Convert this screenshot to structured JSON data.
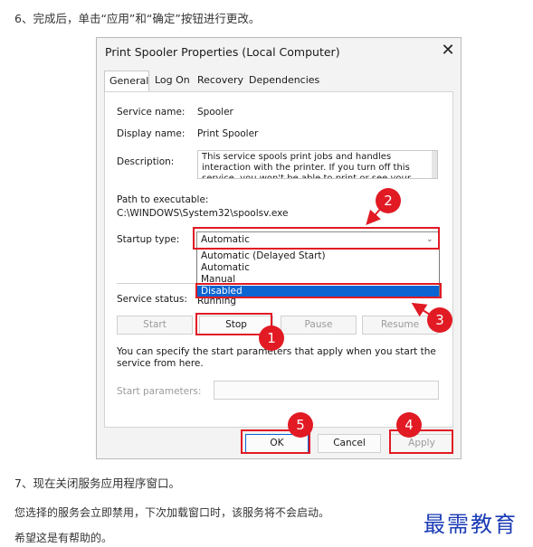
{
  "article": {
    "step6": "6、完成后，单击“应用”和“确定”按钮进行更改。",
    "step7": "7、现在关闭服务应用程序窗口。",
    "note": "您选择的服务会立即禁用，下次加载窗口时，该服务将不会启动。",
    "closing": "希望这是有帮助的。"
  },
  "watermark": "最需教育",
  "dialog": {
    "title": "Print Spooler Properties (Local Computer)",
    "close_glyph": "✕",
    "tabs": [
      {
        "label": "General",
        "active": true
      },
      {
        "label": "Log On",
        "active": false
      },
      {
        "label": "Recovery",
        "active": false
      },
      {
        "label": "Dependencies",
        "active": false
      }
    ],
    "service_name_label": "Service name:",
    "service_name_value": "Spooler",
    "display_name_label": "Display name:",
    "display_name_value": "Print Spooler",
    "description_label": "Description:",
    "description_value": "This service spools print jobs and handles interaction with the printer.  If you turn off this service, you won't be able to print or see your printers.",
    "path_label": "Path to executable:",
    "path_value": "C:\\WINDOWS\\System32\\spoolsv.exe",
    "startup_type_label": "Startup type:",
    "startup_type_value": "Automatic",
    "startup_options": [
      "Automatic (Delayed Start)",
      "Automatic",
      "Manual",
      "Disabled"
    ],
    "startup_selected_index": 3,
    "service_status_label": "Service status:",
    "service_status_value": "Running",
    "buttons": {
      "start": "Start",
      "stop": "Stop",
      "pause": "Pause",
      "resume": "Resume"
    },
    "help_text": "You can specify the start parameters that apply when you start the service from here.",
    "start_params_label": "Start parameters:",
    "start_params_value": "",
    "footer": {
      "ok": "OK",
      "cancel": "Cancel",
      "apply": "Apply"
    }
  },
  "callouts": [
    "1",
    "2",
    "3",
    "4",
    "5"
  ],
  "colors": {
    "highlight": "#e11a24",
    "selection": "#0a64d2",
    "watermark": "#1a3bb5"
  }
}
